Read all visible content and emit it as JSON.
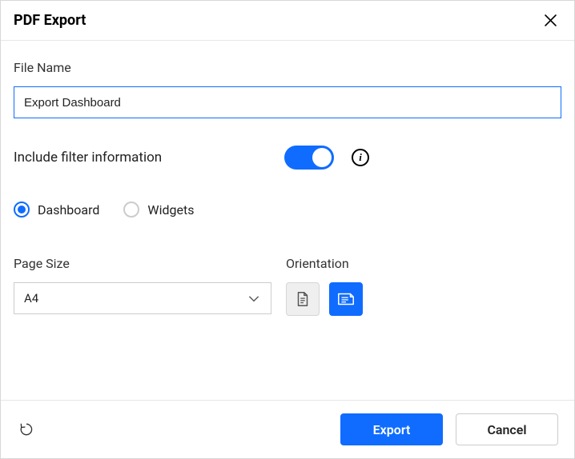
{
  "title": "PDF Export",
  "file_name": {
    "label": "File Name",
    "value": "Export Dashboard"
  },
  "filter": {
    "label": "Include filter information",
    "enabled": true
  },
  "radios": {
    "dashboard": "Dashboard",
    "widgets": "Widgets",
    "selected": "dashboard"
  },
  "page_size": {
    "label": "Page Size",
    "value": "A4"
  },
  "orientation": {
    "label": "Orientation",
    "selected": "landscape"
  },
  "buttons": {
    "export": "Export",
    "cancel": "Cancel"
  }
}
